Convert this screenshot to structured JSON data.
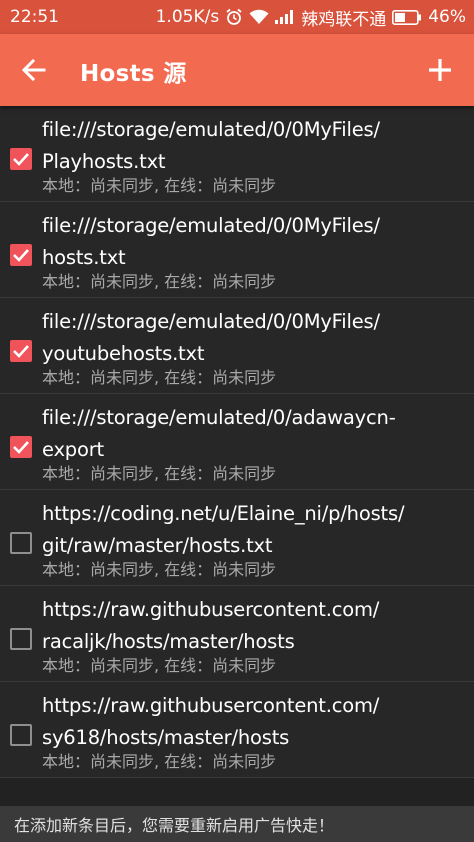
{
  "status_bar": {
    "time": "22:51",
    "net_speed": "1.05K/s",
    "carrier": "辣鸡联不通",
    "battery": "46%",
    "battery_level": 0.46,
    "icons": [
      "alarm-icon",
      "wifi-icon",
      "signal-icon",
      "battery-icon"
    ]
  },
  "app_bar": {
    "title": "Hosts 源",
    "back_icon": "arrow-left-icon",
    "add_icon": "plus-icon"
  },
  "hosts": [
    {
      "url_lines": [
        "file:///storage/emulated/0/0MyFiles/",
        "Playhosts.txt"
      ],
      "status": "本地：尚未同步, 在线：尚未同步",
      "checked": true
    },
    {
      "url_lines": [
        "file:///storage/emulated/0/0MyFiles/",
        "hosts.txt"
      ],
      "status": "本地：尚未同步, 在线：尚未同步",
      "checked": true
    },
    {
      "url_lines": [
        "file:///storage/emulated/0/0MyFiles/",
        "youtubehosts.txt"
      ],
      "status": "本地：尚未同步, 在线：尚未同步",
      "checked": true
    },
    {
      "url_lines": [
        "file:///storage/emulated/0/adawaycn-",
        "export"
      ],
      "status": "本地：尚未同步, 在线：尚未同步",
      "checked": true
    },
    {
      "url_lines": [
        "https://coding.net/u/Elaine_ni/p/hosts/",
        "git/raw/master/hosts.txt"
      ],
      "status": "本地：尚未同步, 在线：尚未同步",
      "checked": false
    },
    {
      "url_lines": [
        "https://raw.githubusercontent.com/",
        "racaljk/hosts/master/hosts"
      ],
      "status": "本地：尚未同步, 在线：尚未同步",
      "checked": false
    },
    {
      "url_lines": [
        "https://raw.githubusercontent.com/",
        "sy618/hosts/master/hosts"
      ],
      "status": "本地：尚未同步, 在线：尚未同步",
      "checked": false
    }
  ],
  "footer": {
    "message": "在添加新条目后，您需要重新启用广告快走！"
  },
  "colors": {
    "status_bar": "#d9523c",
    "app_bar": "#f26a4f",
    "checkbox_on": "#f0535a",
    "background": "#272727"
  }
}
